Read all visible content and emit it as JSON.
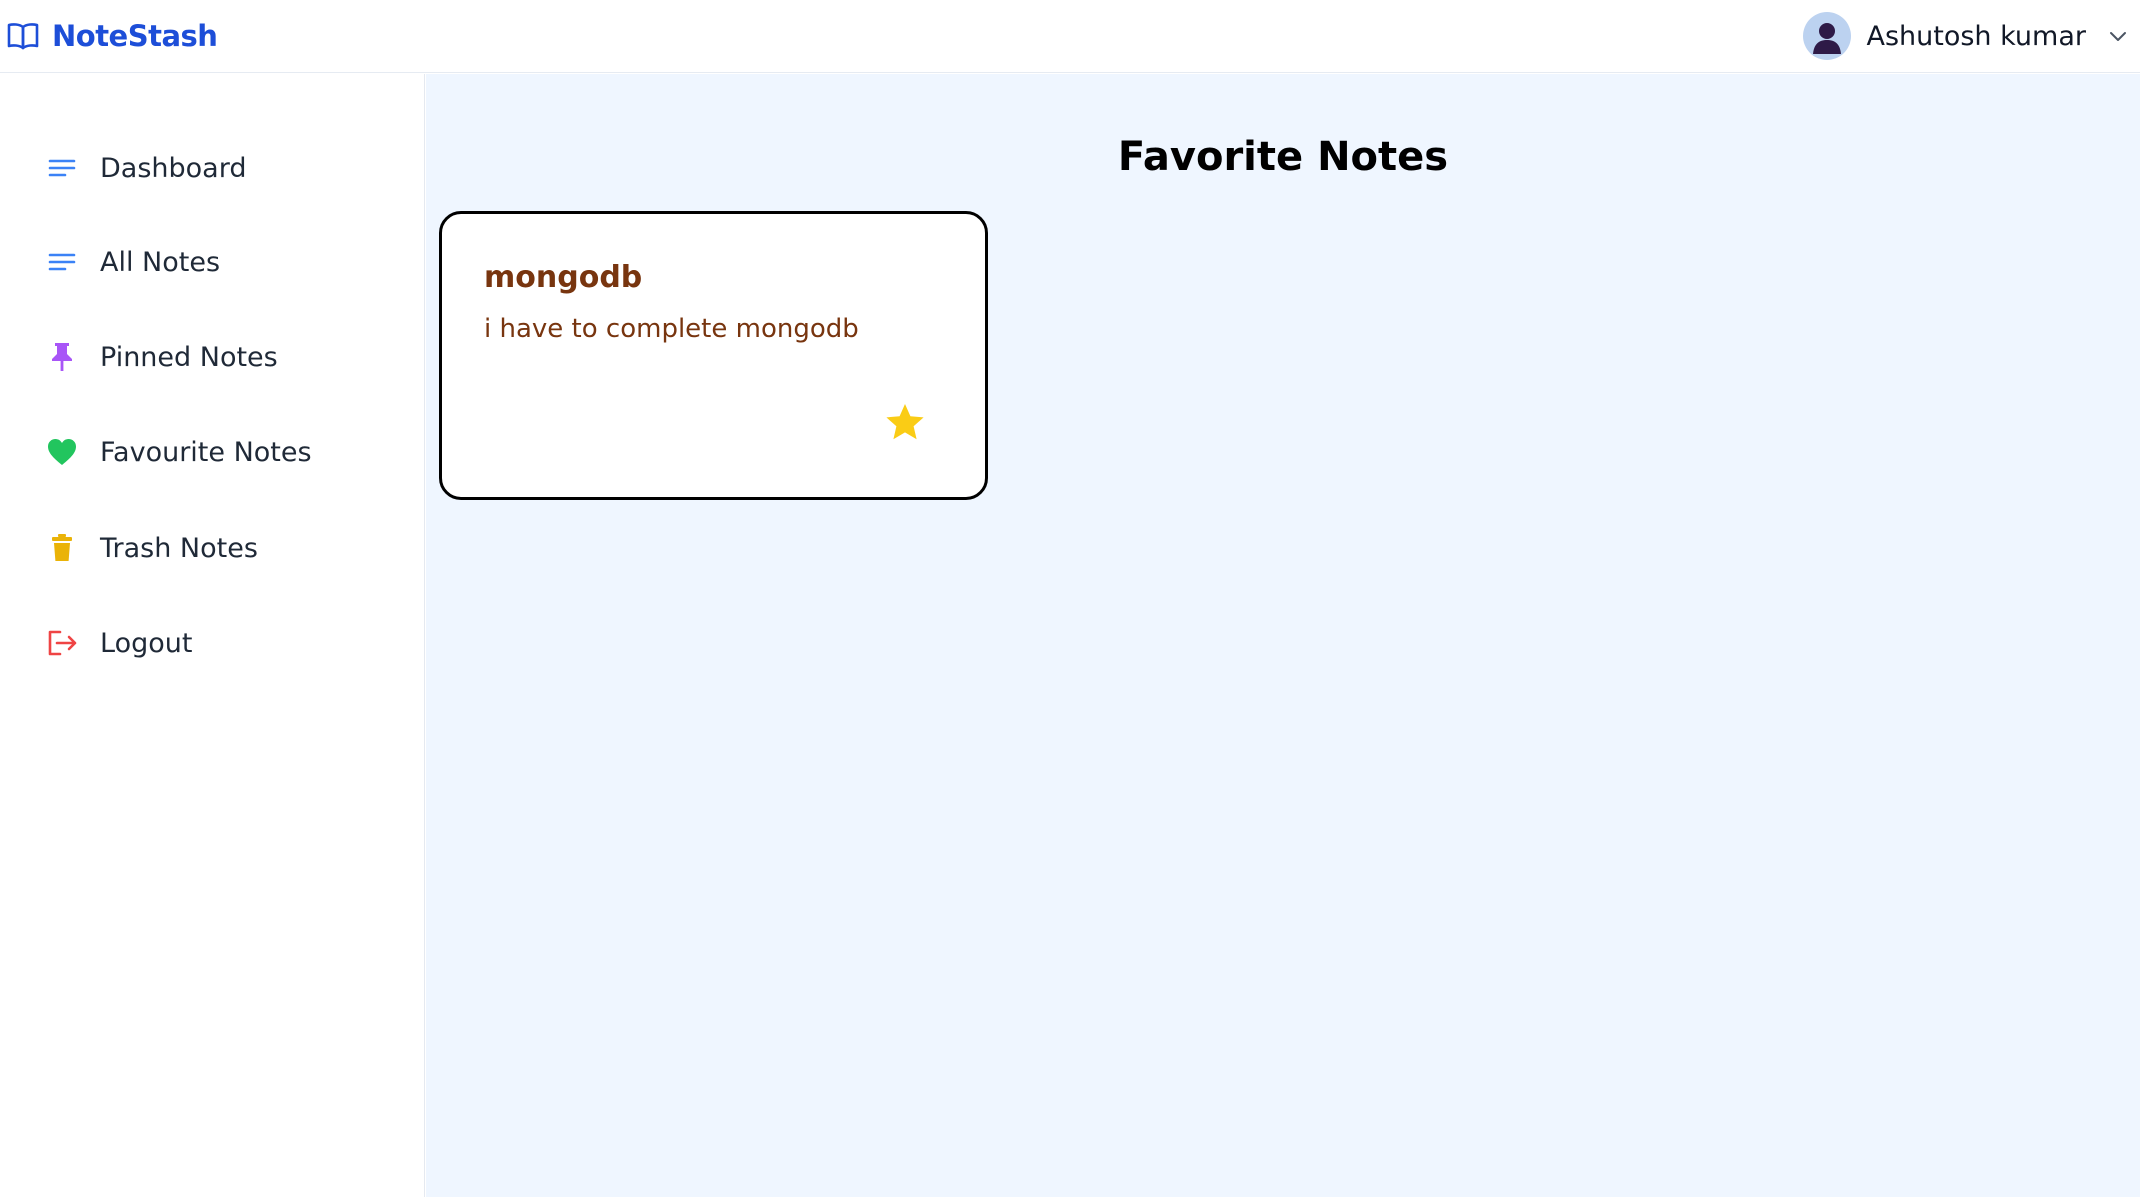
{
  "header": {
    "brand_name": "NoteStash",
    "brand_icon": "open-book-icon",
    "user_name": "Ashutosh kumar",
    "user_menu_icon": "chevron-down-icon",
    "brand_color": "#1d4ed8"
  },
  "sidebar": {
    "items": [
      {
        "label": "Dashboard",
        "icon": "menu-lines-icon",
        "icon_color": "#3b82f6"
      },
      {
        "label": "All Notes",
        "icon": "menu-lines-icon",
        "icon_color": "#3b82f6"
      },
      {
        "label": "Pinned Notes",
        "icon": "pin-icon",
        "icon_color": "#a855f7"
      },
      {
        "label": "Favourite Notes",
        "icon": "heart-icon",
        "icon_color": "#22c55e"
      },
      {
        "label": "Trash Notes",
        "icon": "trash-icon",
        "icon_color": "#eab308"
      },
      {
        "label": "Logout",
        "icon": "logout-icon",
        "icon_color": "#ef4444"
      }
    ]
  },
  "main": {
    "title": "Favorite Notes",
    "background": "#eff6ff",
    "notes": [
      {
        "title": "mongodb",
        "content": "i have to complete mongodb",
        "favorite": true,
        "star_color": "#facc15"
      }
    ]
  }
}
